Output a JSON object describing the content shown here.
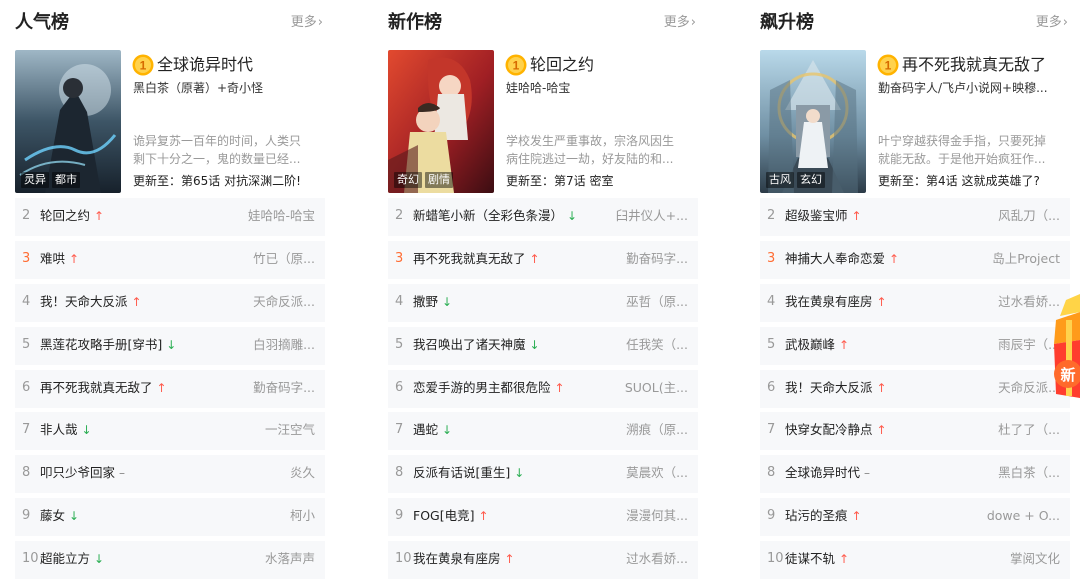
{
  "boards": [
    {
      "title": "人气榜",
      "more_label": "更多",
      "top": {
        "rank": "1",
        "title": "全球诡异时代",
        "author": "黑白茶（原著）+奇小怪",
        "desc": "诡异复苏一百年的时间，人类只剩下十分之一，鬼的数量已经...",
        "update": "更新至：第65话 对抗深渊二阶!",
        "tags": [
          "灵异",
          "都市"
        ]
      },
      "rows": [
        {
          "rank": "2",
          "title": "轮回之约",
          "trend": "↑",
          "trend_type": "up",
          "author": "娃哈哈-哈宝"
        },
        {
          "rank": "3",
          "title": "难哄",
          "trend": "↑",
          "trend_type": "up",
          "author": "竹已（原..."
        },
        {
          "rank": "4",
          "title": "我！天命大反派",
          "trend": "↑",
          "trend_type": "up",
          "author": "天命反派..."
        },
        {
          "rank": "5",
          "title": "黑莲花攻略手册[穿书]",
          "trend": "↓",
          "trend_type": "down",
          "author": "白羽摘雕..."
        },
        {
          "rank": "6",
          "title": "再不死我就真无敌了",
          "trend": "↑",
          "trend_type": "up",
          "author": "勤奋码字..."
        },
        {
          "rank": "7",
          "title": "非人哉",
          "trend": "↓",
          "trend_type": "down",
          "author": "一汪空气"
        },
        {
          "rank": "8",
          "title": "叩只少爷回家",
          "trend": "–",
          "trend_type": "flat",
          "author": "炎久"
        },
        {
          "rank": "9",
          "title": "藤女",
          "trend": "↓",
          "trend_type": "down",
          "author": "柯小"
        },
        {
          "rank": "10",
          "title": "超能立方",
          "trend": "↓",
          "trend_type": "down",
          "author": "水落声声"
        }
      ]
    },
    {
      "title": "新作榜",
      "more_label": "更多",
      "top": {
        "rank": "1",
        "title": "轮回之约",
        "author": "娃哈哈-哈宝",
        "desc": "学校发生严重事故，宗洛风因生病住院逃过一劫，好友陆的和...",
        "update": "更新至：第7话 密室",
        "tags": [
          "奇幻",
          "剧情"
        ]
      },
      "rows": [
        {
          "rank": "2",
          "title": "新蜡笔小新（全彩色条漫）",
          "trend": "↓",
          "trend_type": "down",
          "author": "臼井仪人+..."
        },
        {
          "rank": "3",
          "title": "再不死我就真无敌了",
          "trend": "↑",
          "trend_type": "up",
          "author": "勤奋码字..."
        },
        {
          "rank": "4",
          "title": "撒野",
          "trend": "↓",
          "trend_type": "down",
          "author": "巫哲（原..."
        },
        {
          "rank": "5",
          "title": "我召唤出了诸天神魔",
          "trend": "↓",
          "trend_type": "down",
          "author": "任我笑（..."
        },
        {
          "rank": "6",
          "title": "恋爱手游的男主都很危险",
          "trend": "↑",
          "trend_type": "up",
          "author": "SUOL(主..."
        },
        {
          "rank": "7",
          "title": "遇蛇",
          "trend": "↓",
          "trend_type": "down",
          "author": "溯痕（原..."
        },
        {
          "rank": "8",
          "title": "反派有话说[重生]",
          "trend": "↓",
          "trend_type": "down",
          "author": "莫晨欢（..."
        },
        {
          "rank": "9",
          "title": "FOG[电竞]",
          "trend": "↑",
          "trend_type": "up",
          "author": "漫漫何其..."
        },
        {
          "rank": "10",
          "title": "我在黄泉有座房",
          "trend": "↑",
          "trend_type": "up",
          "author": "过水看娇..."
        }
      ]
    },
    {
      "title": "飙升榜",
      "more_label": "更多",
      "top": {
        "rank": "1",
        "title": "再不死我就真无敌了",
        "author": "勤奋码字人/飞卢小说网+映穆...",
        "desc": "叶宁穿越获得金手指，只要死掉就能无敌。于是他开始疯狂作...",
        "update": "更新至：第4话 这就成英雄了?",
        "tags": [
          "古风",
          "玄幻"
        ]
      },
      "rows": [
        {
          "rank": "2",
          "title": "超级鉴宝师",
          "trend": "↑",
          "trend_type": "up",
          "author": "风乱刀（..."
        },
        {
          "rank": "3",
          "title": "神捕大人奉命恋爱",
          "trend": "↑",
          "trend_type": "up",
          "author": "岛上Project"
        },
        {
          "rank": "4",
          "title": "我在黄泉有座房",
          "trend": "↑",
          "trend_type": "up",
          "author": "过水看娇..."
        },
        {
          "rank": "5",
          "title": "武极巅峰",
          "trend": "↑",
          "trend_type": "up",
          "author": "雨辰宇（..."
        },
        {
          "rank": "6",
          "title": "我！天命大反派",
          "trend": "↑",
          "trend_type": "up",
          "author": "天命反派..."
        },
        {
          "rank": "7",
          "title": "快穿女配冷静点",
          "trend": "↑",
          "trend_type": "up",
          "author": "杜了了（..."
        },
        {
          "rank": "8",
          "title": "全球诡异时代",
          "trend": "–",
          "trend_type": "flat",
          "author": "黑白茶（..."
        },
        {
          "rank": "9",
          "title": "玷污的圣痕",
          "trend": "↑",
          "trend_type": "up",
          "author": "dowe + O..."
        },
        {
          "rank": "10",
          "title": "徒谋不轨",
          "trend": "↑",
          "trend_type": "up",
          "author": "掌阅文化"
        }
      ]
    }
  ],
  "colors": {
    "hot_rank": "#ff6d34",
    "trend_up": "#ff5b4d",
    "trend_down": "#2bae53",
    "row_bg": "#f7f8fa",
    "medal": "#ffb300"
  },
  "gift_badge_text": "新"
}
